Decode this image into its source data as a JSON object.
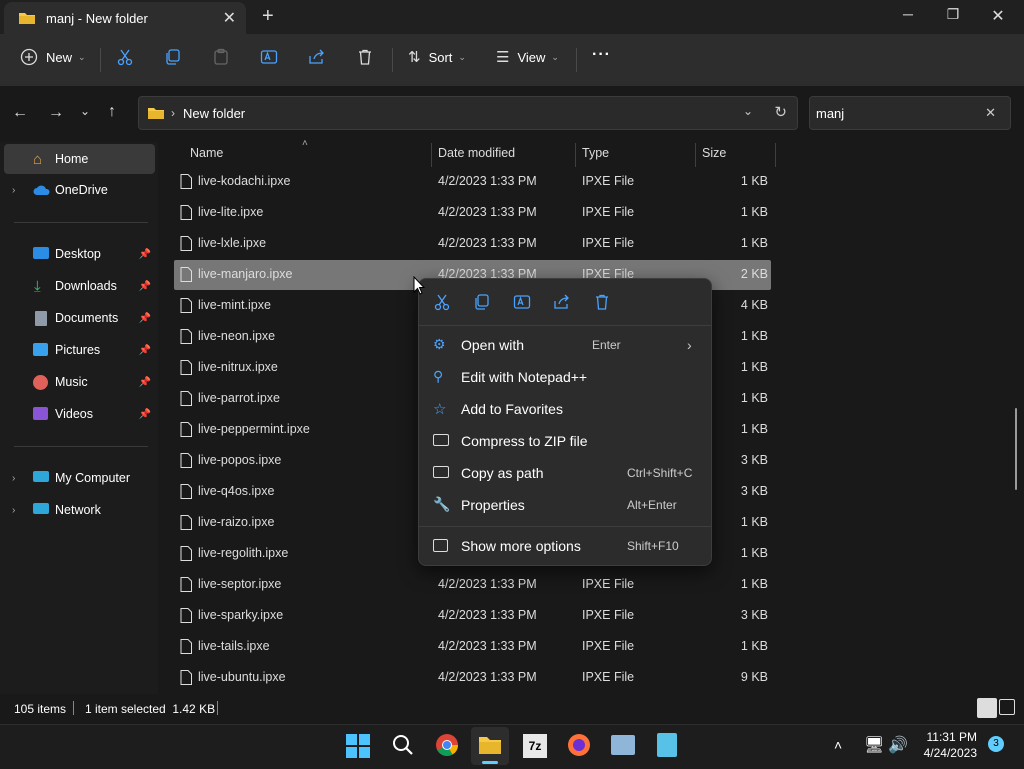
{
  "window": {
    "tab_title": "manj - New folder",
    "new_tab": "+",
    "minimize": "─",
    "maximize": "❐",
    "close": "✕"
  },
  "toolbar": {
    "new_label": "New",
    "sort_label": "Sort",
    "view_label": "View",
    "more_label": "···"
  },
  "address": {
    "path": "New folder",
    "search_value": "manj"
  },
  "sidebar": {
    "items": [
      {
        "label": "Home"
      },
      {
        "label": "OneDrive"
      },
      {
        "label": "Desktop"
      },
      {
        "label": "Downloads"
      },
      {
        "label": "Documents"
      },
      {
        "label": "Pictures"
      },
      {
        "label": "Music"
      },
      {
        "label": "Videos"
      },
      {
        "label": "My Computer"
      },
      {
        "label": "Network"
      }
    ]
  },
  "columns": {
    "name": "Name",
    "date": "Date modified",
    "type": "Type",
    "size": "Size"
  },
  "files": [
    {
      "name": "live-kodachi.ipxe",
      "date": "4/2/2023 1:33 PM",
      "type": "IPXE File",
      "size": "1 KB"
    },
    {
      "name": "live-lite.ipxe",
      "date": "4/2/2023 1:33 PM",
      "type": "IPXE File",
      "size": "1 KB"
    },
    {
      "name": "live-lxle.ipxe",
      "date": "4/2/2023 1:33 PM",
      "type": "IPXE File",
      "size": "1 KB"
    },
    {
      "name": "live-manjaro.ipxe",
      "date": "4/2/2023 1:33 PM",
      "type": "IPXE File",
      "size": "2 KB"
    },
    {
      "name": "live-mint.ipxe",
      "date": "",
      "type": "",
      "size": "4 KB"
    },
    {
      "name": "live-neon.ipxe",
      "date": "",
      "type": "",
      "size": "1 KB"
    },
    {
      "name": "live-nitrux.ipxe",
      "date": "",
      "type": "",
      "size": "1 KB"
    },
    {
      "name": "live-parrot.ipxe",
      "date": "",
      "type": "",
      "size": "1 KB"
    },
    {
      "name": "live-peppermint.ipxe",
      "date": "",
      "type": "",
      "size": "1 KB"
    },
    {
      "name": "live-popos.ipxe",
      "date": "",
      "type": "",
      "size": "3 KB"
    },
    {
      "name": "live-q4os.ipxe",
      "date": "",
      "type": "",
      "size": "3 KB"
    },
    {
      "name": "live-raizo.ipxe",
      "date": "",
      "type": "",
      "size": "1 KB"
    },
    {
      "name": "live-regolith.ipxe",
      "date": "",
      "type": "",
      "size": "1 KB"
    },
    {
      "name": "live-septor.ipxe",
      "date": "4/2/2023 1:33 PM",
      "type": "IPXE File",
      "size": "1 KB"
    },
    {
      "name": "live-sparky.ipxe",
      "date": "4/2/2023 1:33 PM",
      "type": "IPXE File",
      "size": "3 KB"
    },
    {
      "name": "live-tails.ipxe",
      "date": "4/2/2023 1:33 PM",
      "type": "IPXE File",
      "size": "1 KB"
    },
    {
      "name": "live-ubuntu.ipxe",
      "date": "4/2/2023 1:33 PM",
      "type": "IPXE File",
      "size": "9 KB"
    }
  ],
  "context_menu": {
    "items": [
      {
        "label": "Open with",
        "shortcut": "Enter",
        "icon": "open-with-icon"
      },
      {
        "label": "Edit with Notepad++",
        "shortcut": "",
        "icon": "notepad-pin-icon"
      },
      {
        "label": "Add to Favorites",
        "shortcut": "",
        "icon": "star-icon"
      },
      {
        "label": "Compress to ZIP file",
        "shortcut": "",
        "icon": "zip-icon"
      },
      {
        "label": "Copy as path",
        "shortcut": "Ctrl+Shift+C",
        "icon": "copy-path-icon"
      },
      {
        "label": "Properties",
        "shortcut": "Alt+Enter",
        "icon": "wrench-icon"
      },
      {
        "label": "Show more options",
        "shortcut": "Shift+F10",
        "icon": "more-options-icon"
      }
    ]
  },
  "status": {
    "count": "105 items",
    "selected": "1 item selected  1.42 KB"
  },
  "taskbar": {
    "time": "11:31 PM",
    "date": "4/24/2023",
    "notif_count": "3"
  },
  "colors": {
    "accent": "#60cdff",
    "folder": "#f7c948",
    "selection": "#777777"
  }
}
